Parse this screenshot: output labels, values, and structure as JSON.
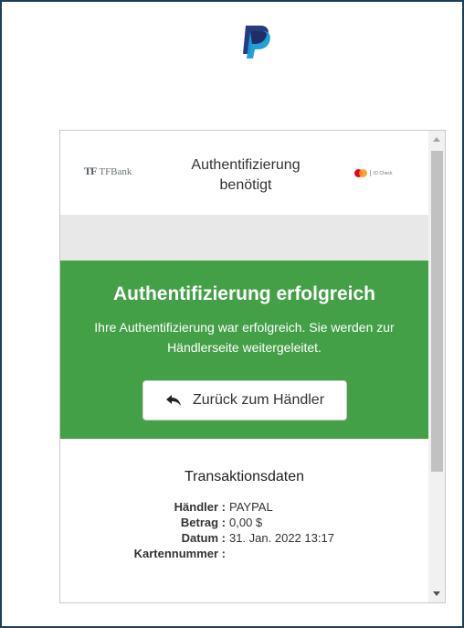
{
  "header": {
    "paypal_icon": "paypal-logo-icon"
  },
  "auth_frame": {
    "bank_logo_mark": "TF",
    "bank_logo_text": "TFBank",
    "title": "Authentifizierung benötigt",
    "idcheck_text": "ID Check",
    "colors": {
      "success_green": "#43a047",
      "band_gray": "#e8e8e8"
    }
  },
  "success": {
    "title": "Authentifizierung erfolgreich",
    "message": "Ihre Authentifizierung war erfolgreich. Sie werden zur Händlerseite weitergeleitet.",
    "back_button_label": "Zurück zum Händler",
    "back_icon": "reply-arrow-icon"
  },
  "transaction": {
    "title": "Transaktionsdaten",
    "rows": [
      {
        "label": "Händler :",
        "value": "PAYPAL"
      },
      {
        "label": "Betrag :",
        "value": "0,00 $"
      },
      {
        "label": "Datum :",
        "value": "31. Jan. 2022 13:17"
      },
      {
        "label": "Kartennummer :",
        "value": ""
      }
    ]
  }
}
